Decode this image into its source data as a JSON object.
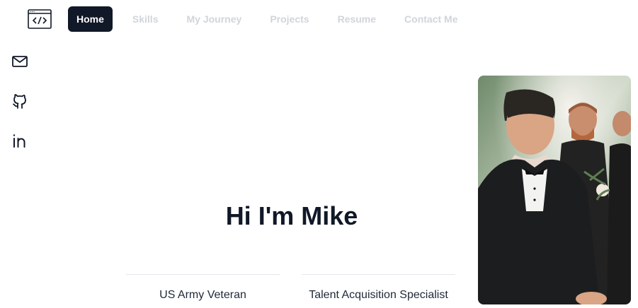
{
  "nav": {
    "items": [
      {
        "label": "Home",
        "active": true
      },
      {
        "label": "Skills",
        "active": false
      },
      {
        "label": "My Journey",
        "active": false
      },
      {
        "label": "Projects",
        "active": false
      },
      {
        "label": "Resume",
        "active": false
      },
      {
        "label": "Contact Me",
        "active": false
      }
    ]
  },
  "logo": {
    "icon": "code-window-icon"
  },
  "social": [
    {
      "icon": "mail-icon"
    },
    {
      "icon": "github-icon"
    },
    {
      "icon": "linkedin-icon"
    }
  ],
  "hero": {
    "headline": "Hi I'm Mike",
    "roles": [
      "US Army Veteran",
      "Talent Acquisition Specialist"
    ]
  },
  "photo": {
    "description": "profile-photo",
    "icon": "portrait-image"
  },
  "colors": {
    "nav_active_bg": "#111827",
    "nav_inactive_text": "#d1d5db",
    "text": "#111827",
    "divider": "#e5e7eb"
  }
}
